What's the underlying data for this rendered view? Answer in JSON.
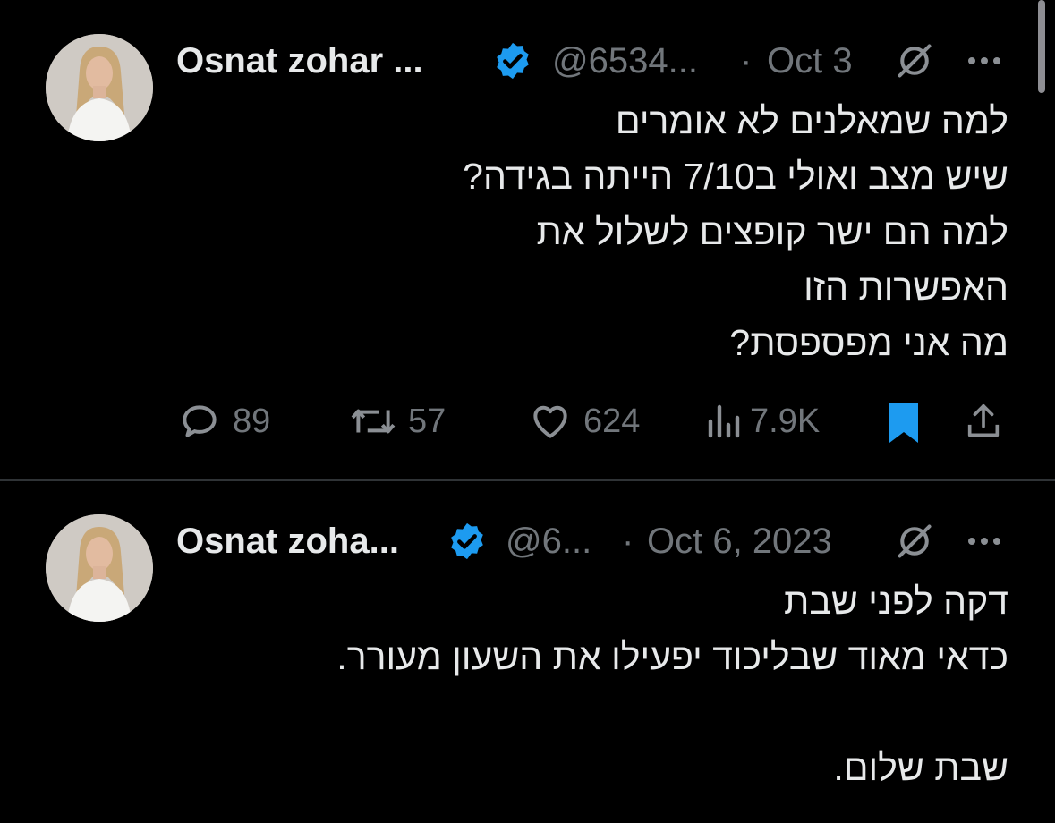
{
  "tweets": [
    {
      "name": "Osnat zohar ...",
      "handle": "@6534...",
      "separator": "·",
      "date": "Oct 3",
      "lines": [
        "למה שמאלנים לא אומרים",
        "שיש מצב ואולי ב7/10 הייתה בגידה?",
        "למה הם ישר קופצים לשלול את",
        "האפשרות הזו",
        "מה אני מפספסת?"
      ],
      "stats": {
        "replies": "89",
        "reposts": "57",
        "likes": "624",
        "views": "7.9K"
      },
      "bookmarked": true
    },
    {
      "name": "Osnat zoha...",
      "handle": "@6...",
      "separator": "·",
      "date": "Oct 6, 2023",
      "lines": [
        "דקה לפני שבת",
        "כדאי מאוד שבליכוד יפעילו את השעון מעורר.",
        "",
        "שבת שלום."
      ]
    }
  ],
  "colors": {
    "background": "#000000",
    "text": "#e7e9ea",
    "muted": "#71767b",
    "verified": "#1d9bf0",
    "bookmark_active": "#1d9bf0",
    "divider": "#2f3336"
  },
  "icons": [
    "verified-badge-icon",
    "grok-icon",
    "more-icon",
    "reply-icon",
    "repost-icon",
    "like-icon",
    "views-icon",
    "bookmark-icon",
    "share-icon"
  ]
}
